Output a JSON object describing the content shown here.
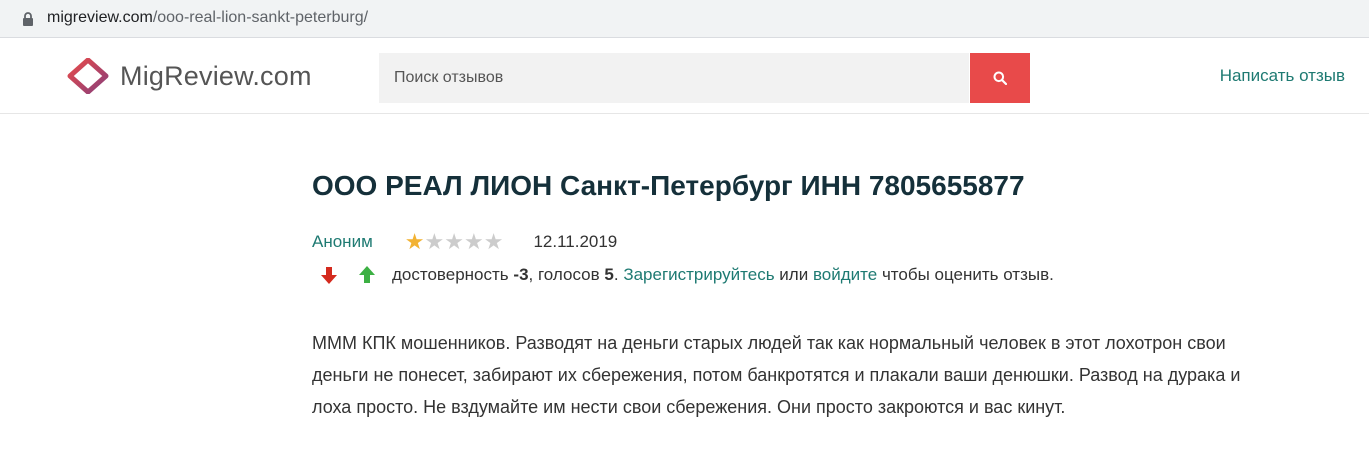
{
  "browser": {
    "url_domain": "migreview.com",
    "url_path": "/ooo-real-lion-sankt-peterburg/"
  },
  "header": {
    "logo_text": "MigReview.com",
    "search_placeholder": "Поиск отзывов",
    "write_review_label": "Написать отзыв"
  },
  "review": {
    "title": "ООО РЕАЛ ЛИОН Санкт-Петербург ИНН 7805655877",
    "author": "Аноним",
    "rating": 1,
    "rating_max": 5,
    "date": "12.11.2019",
    "vote": {
      "reliability_label": "достоверность",
      "reliability_value": "-3",
      "votes_label": ", голосов",
      "votes_value": "5",
      "after_votes": ".",
      "register_link": "Зарегистрируйтесь",
      "or_text": "или",
      "login_link": "войдите",
      "tail_text": "чтобы оценить отзыв."
    },
    "body": "МММ КПК мошенников. Разводят на деньги старых людей так как нормальный человек в этот лохотрон свои деньги не понесет, забирают их сбережения, потом банкротятся и плакали ваши денюшки. Развод на дурака и лоха просто. Не вздумайте им нести свои сбережения. Они просто закроются и вас кинут."
  },
  "colors": {
    "accent": "#1e7a72",
    "search_button": "#e84a4a",
    "star_filled": "#f2b233",
    "star_empty": "#cccccc",
    "downvote": "#d42a1e",
    "upvote": "#3cb043"
  },
  "icons": {
    "lock": "lock-icon",
    "logo": "migreview-logo-icon",
    "search": "search-icon",
    "downvote": "arrow-down-icon",
    "upvote": "arrow-up-icon",
    "star": "star-icon"
  }
}
